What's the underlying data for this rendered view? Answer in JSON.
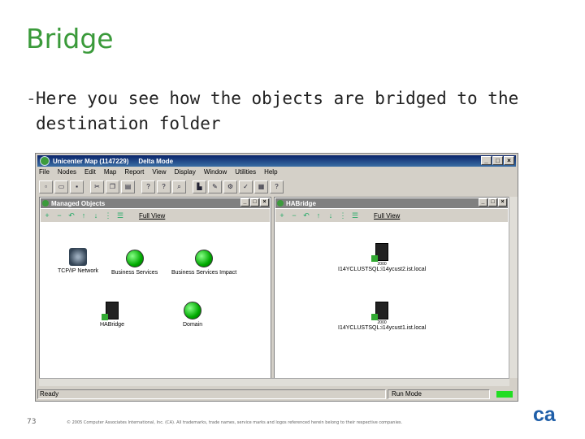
{
  "slide": {
    "title": "Bridge",
    "bullet_dash": "-",
    "bullet_text": "Here you see how the objects are bridged to the destination folder",
    "page_number": "73",
    "copyright": "© 2005 Computer Associates International, Inc. (CA). All trademarks, trade names, service marks and logos referenced herein belong to their respective companies.",
    "logo_text": "ca"
  },
  "app": {
    "title": "Unicenter Map (1147229)",
    "mode": "Delta Mode",
    "menu": [
      "File",
      "Nodes",
      "Edit",
      "Map",
      "Report",
      "View",
      "Display",
      "Window",
      "Utilities",
      "Help"
    ],
    "toolbar_icons": [
      "new-icon",
      "open-icon",
      "save-icon",
      "cut-icon",
      "copy-icon",
      "paste-icon",
      "query-icon",
      "help-icon",
      "find-icon",
      "chart-icon",
      "chart-edit-icon",
      "settings-icon",
      "check-icon",
      "report-icon",
      "help-context-icon"
    ],
    "status": {
      "ready": "Ready",
      "mode": "Run Mode",
      "indicator_color": "#22dd22"
    }
  },
  "panes": {
    "managed": {
      "title": "Managed Objects",
      "fullview": "Full View",
      "objects": [
        {
          "label": "TCP/IP Network",
          "icon": "network-globe-icon"
        },
        {
          "label": "Business Services",
          "icon": "green-ball-icon"
        },
        {
          "label": "Business Services Impact",
          "icon": "green-ball-icon"
        },
        {
          "label": "HABridge",
          "icon": "server-icon"
        },
        {
          "label": "Domain",
          "icon": "green-ball-icon"
        }
      ]
    },
    "habridge": {
      "title": "HABridge",
      "fullview": "Full View",
      "objects": [
        {
          "label": "I14YCLUSTSQL:i14ycust2.ist.local",
          "icon": "server-icon",
          "badge": "2000"
        },
        {
          "label": "I14YCLUSTSQL:i14ycust1.ist.local",
          "icon": "server-icon",
          "badge": "2000"
        }
      ]
    }
  },
  "glyphs": {
    "min": "_",
    "max": "□",
    "close": "×",
    "plus": "+",
    "minus": "−"
  }
}
